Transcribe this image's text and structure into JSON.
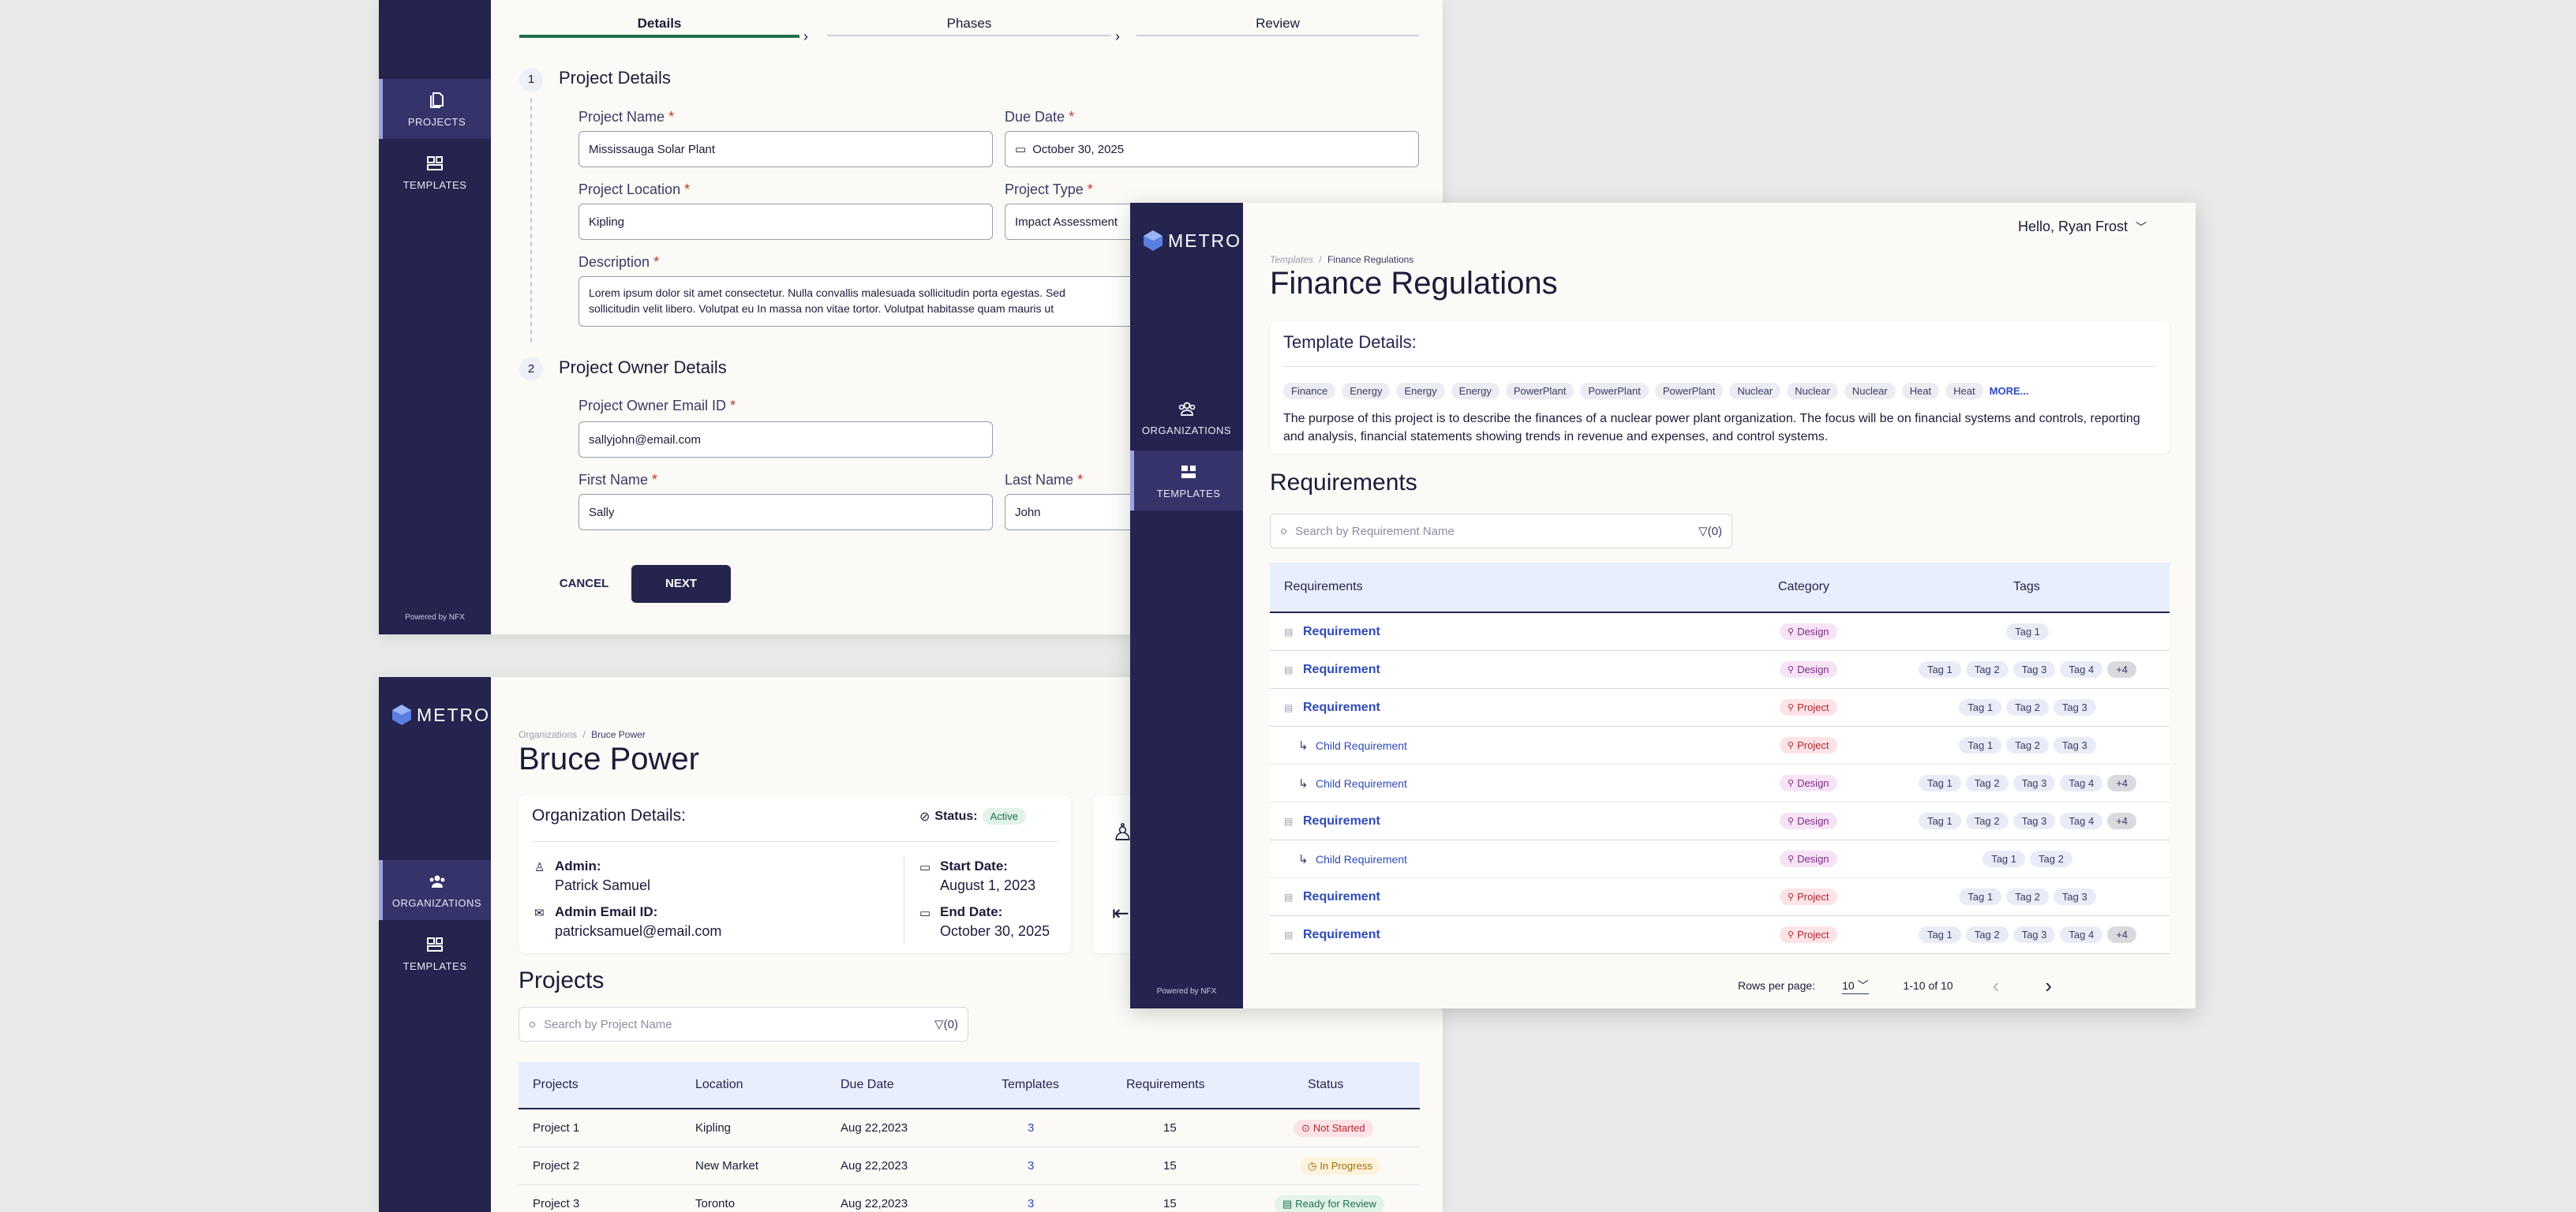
{
  "brand": {
    "name": "METRO",
    "powered": "Powered by NFX"
  },
  "wizard": {
    "nav": {
      "projects": "PROJECTS",
      "templates": "TEMPLATES"
    },
    "steps": [
      "Details",
      "Phases",
      "Review"
    ],
    "section1": {
      "num": "1",
      "title": "Project Details"
    },
    "section2": {
      "num": "2",
      "title": "Project Owner Details"
    },
    "required_mark": "*",
    "fields": {
      "project_name": {
        "label": "Project Name",
        "value": "Mississauga Solar Plant"
      },
      "due_date": {
        "label": "Due Date",
        "value": "October 30, 2025"
      },
      "project_location": {
        "label": "Project Location",
        "value": "Kipling"
      },
      "project_type": {
        "label": "Project Type",
        "value": "Impact Assessment"
      },
      "description": {
        "label": "Description",
        "value_line1": "Lorem ipsum dolor sit amet consectetur. Nulla convallis malesuada sollicitudin porta egestas. Sed",
        "value_line2": "sollicitudin velit libero. Volutpat eu  In massa non vitae tortor. Volutpat habitasse quam mauris ut"
      },
      "owner_email": {
        "label": "Project Owner Email ID",
        "value": "sallyjohn@email.com"
      },
      "first_name": {
        "label": "First Name",
        "value": "Sally"
      },
      "last_name": {
        "label": "Last Name",
        "value": "John"
      }
    },
    "cancel": "CANCEL",
    "next": "NEXT"
  },
  "org": {
    "nav": {
      "organizations": "ORGANIZATIONS",
      "templates": "TEMPLATES"
    },
    "breadcrumb": {
      "root": "Organizations",
      "sep": "/",
      "current": "Bruce Power"
    },
    "title": "Bruce Power",
    "details_title": "Organization Details:",
    "status_label": "Status:",
    "status_value": "Active",
    "admin_label": "Admin:",
    "admin_value": "Patrick Samuel",
    "admin_email_label": "Admin Email ID:",
    "admin_email_value": "patricksamuel@email.com",
    "start_label": "Start Date:",
    "start_value": "August 1, 2023",
    "end_label": "End Date:",
    "end_value": "October 30, 2025",
    "projects_title": "Projects",
    "search_placeholder": "Search by Project Name",
    "filter": "(0)",
    "columns": [
      "Projects",
      "Location",
      "Due Date",
      "Templates",
      "Requirements",
      "Status"
    ],
    "rows": [
      {
        "name": "Project 1",
        "location": "Kipling",
        "due": "Aug 22,2023",
        "templates": "3",
        "reqs": "15",
        "status": "Not Started"
      },
      {
        "name": "Project 2",
        "location": "New Market",
        "due": "Aug 22,2023",
        "templates": "3",
        "reqs": "15",
        "status": "In Progress"
      },
      {
        "name": "Project 3",
        "location": "Toronto",
        "due": "Aug 22,2023",
        "templates": "3",
        "reqs": "15",
        "status": "Ready for Review"
      }
    ]
  },
  "template": {
    "greeting": "Hello, Ryan Frost",
    "nav": {
      "organizations": "ORGANIZATIONS",
      "templates": "TEMPLATES"
    },
    "breadcrumb": {
      "root": "Templates",
      "sep": "/",
      "current": "Finance Regulations"
    },
    "title": "Finance Regulations",
    "details_title": "Template Details:",
    "chips": [
      "Finance",
      "Energy",
      "Energy",
      "Energy",
      "PowerPlant",
      "PowerPlant",
      "PowerPlant",
      "Nuclear",
      "Nuclear",
      "Nuclear",
      "Heat",
      "Heat"
    ],
    "more": "MORE...",
    "description": "The purpose of this project is to describe the finances of a nuclear power plant organization. The focus will be on financial systems and controls, reporting and analysis, financial statements showing trends in revenue and expenses, and control systems.",
    "req_title": "Requirements",
    "search_placeholder": "Search by Requirement Name",
    "filter": "(0)",
    "columns": [
      "Requirements",
      "Category",
      "Tags"
    ],
    "rows": [
      {
        "name": "Requirement",
        "child": false,
        "category": "Design",
        "tags": [
          "Tag 1"
        ],
        "more": ""
      },
      {
        "name": "Requirement",
        "child": false,
        "category": "Design",
        "tags": [
          "Tag 1",
          "Tag 2",
          "Tag 3",
          "Tag 4"
        ],
        "more": "+4"
      },
      {
        "name": "Requirement",
        "child": false,
        "category": "Project",
        "tags": [
          "Tag 1",
          "Tag 2",
          "Tag 3"
        ],
        "more": ""
      },
      {
        "name": "Child Requirement",
        "child": true,
        "category": "Project",
        "tags": [
          "Tag 1",
          "Tag 2",
          "Tag 3"
        ],
        "more": ""
      },
      {
        "name": "Child Requirement",
        "child": true,
        "category": "Design",
        "tags": [
          "Tag 1",
          "Tag 2",
          "Tag 3",
          "Tag 4"
        ],
        "more": "+4"
      },
      {
        "name": "Requirement",
        "child": false,
        "category": "Design",
        "tags": [
          "Tag 1",
          "Tag 2",
          "Tag 3",
          "Tag 4"
        ],
        "more": "+4"
      },
      {
        "name": "Child Requirement",
        "child": true,
        "category": "Design",
        "tags": [
          "Tag 1",
          "Tag 2"
        ],
        "more": ""
      },
      {
        "name": "Requirement",
        "child": false,
        "category": "Project",
        "tags": [
          "Tag 1",
          "Tag 2",
          "Tag 3"
        ],
        "more": ""
      },
      {
        "name": "Requirement",
        "child": false,
        "category": "Project",
        "tags": [
          "Tag 1",
          "Tag 2",
          "Tag 3",
          "Tag 4"
        ],
        "more": "+4"
      }
    ],
    "rows_per_page_label": "Rows per page:",
    "rows_per_page": "10",
    "range": "1-10 of 10"
  }
}
